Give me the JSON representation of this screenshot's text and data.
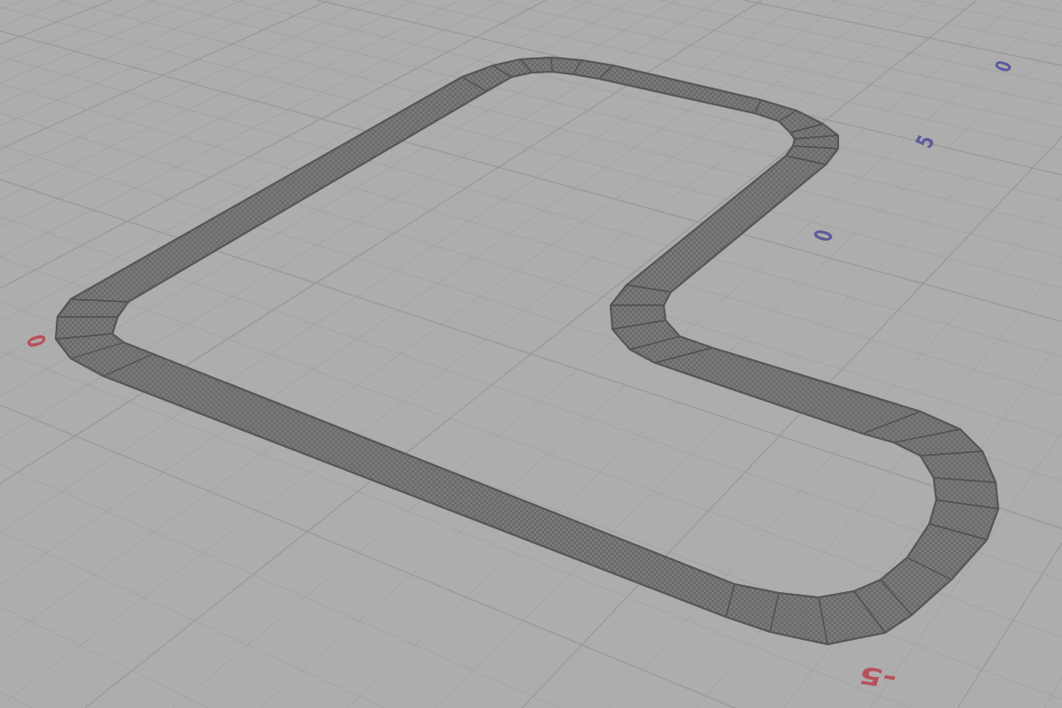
{
  "viewport": {
    "axis_labels": [
      {
        "text": "0",
        "color": "#5c5c9a"
      },
      {
        "text": "5",
        "color": "#5c5c9a"
      },
      {
        "text": "0",
        "color": "#5c5c9a"
      },
      {
        "text": "0",
        "color": "#b8505c"
      },
      {
        "text": "-5",
        "color": "#b8505c"
      }
    ]
  }
}
